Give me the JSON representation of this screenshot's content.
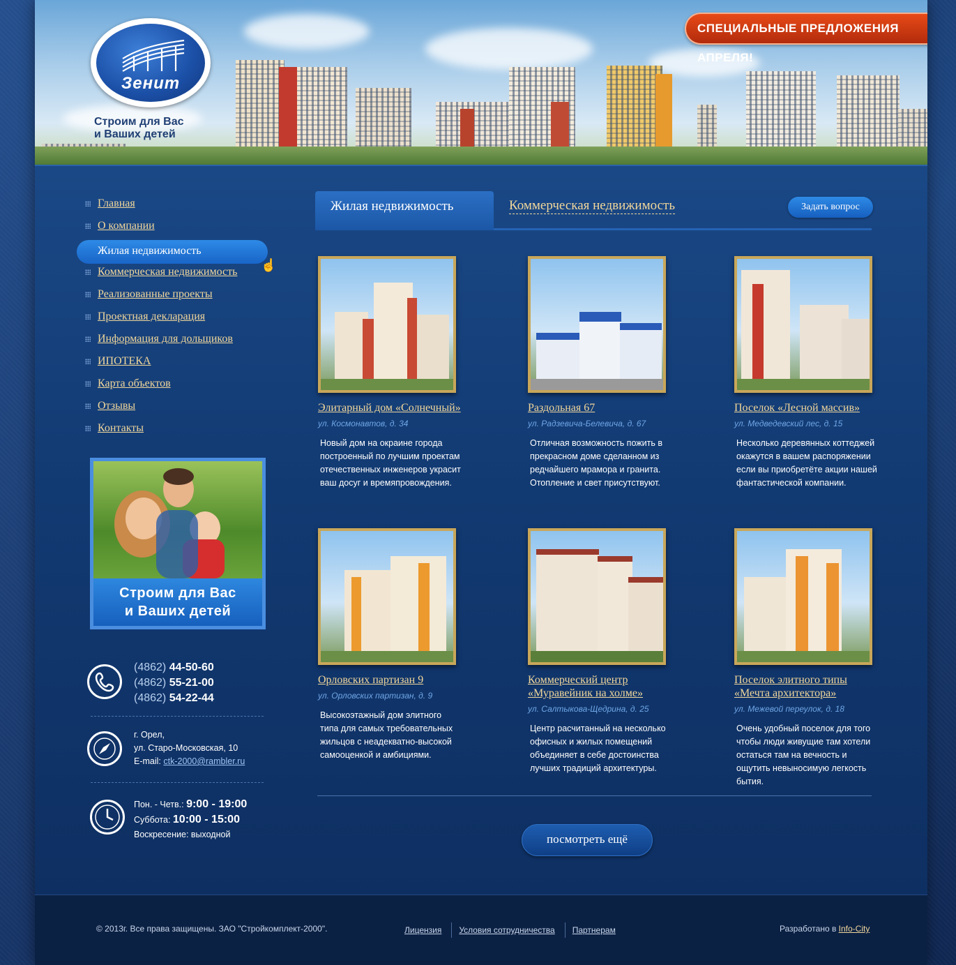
{
  "header": {
    "logo_text": "Зенит",
    "slogan_line1": "Строим для Вас",
    "slogan_line2": "и Ваших детей",
    "special_offer": "СПЕЦИАЛЬНЫЕ ПРЕДЛОЖЕНИЯ АПРЕЛЯ!"
  },
  "nav": {
    "items": [
      {
        "label": "Главная"
      },
      {
        "label": "О компании"
      },
      {
        "label": "Жилая недвижимость"
      },
      {
        "label": "Коммерческая недвижимость"
      },
      {
        "label": "Реализованные проекты"
      },
      {
        "label": "Проектная декларация"
      },
      {
        "label": "Информация для дольщиков"
      },
      {
        "label": "ИПОТЕКА"
      },
      {
        "label": "Карта объектов"
      },
      {
        "label": "Отзывы"
      },
      {
        "label": "Контакты"
      }
    ],
    "active_index": 2
  },
  "promo": {
    "line1": "Строим для Вас",
    "line2": "и Ваших детей"
  },
  "contacts": {
    "phones": [
      {
        "code": "(4862) ",
        "number": "44-50-60"
      },
      {
        "code": "(4862) ",
        "number": "55-21-00"
      },
      {
        "code": "(4862) ",
        "number": "54-22-44"
      }
    ],
    "city": "г. Орел,",
    "street": "ул. Старо-Московская, 10",
    "email_label": "E-mail: ",
    "email": "ctk-2000@rambler.ru",
    "hours": {
      "weekdays_label": "Пон. - Четв.: ",
      "weekdays_value": "9:00 - 19:00",
      "saturday_label": "Суббота: ",
      "saturday_value": "10:00 - 15:00",
      "sunday": "Воскресение: выходной"
    }
  },
  "tabs": {
    "active": "Жилая недвижимость",
    "other": "Коммерческая недвижимость",
    "ask_button": "Задать вопрос"
  },
  "cards": [
    {
      "title": "Элитарный дом «Солнечный»",
      "address": "ул. Космонавтов, д. 34",
      "description": "Новый дом на окраине города построенный по лучшим проектам отечественных инженеров украсит ваш досуг и времяпровождения."
    },
    {
      "title": "Раздольная 67",
      "address": "ул. Радзевича-Белевича, д. 67",
      "description": "Отличная возможность пожить в прекрасном доме сделанном из редчайшего мрамора и гранита. Отопление и свет присутствуют."
    },
    {
      "title": "Поселок «Лесной массив»",
      "address": "ул. Медведевский лес, д. 15",
      "description": "Несколько деревянных коттеджей окажутся в вашем распоряжении если вы приобретёте акции нашей фантастической компании."
    },
    {
      "title": "Орловских партизан 9",
      "address": "ул. Орловских партизан, д. 9",
      "description": "Высокоэтажный дом элитного типа для самых требовательных жильцов с неадекватно-высокой самооценкой и амбициями."
    },
    {
      "title": "Коммерческий центр «Муравейник на холме»",
      "address": "ул. Салтыкова-Щедрина, д. 25",
      "description": "Центр расчитанный на несколько офисных и жилых помещений объединяет в себе достоинства лучших традиций архитектуры."
    },
    {
      "title": "Поселок элитного типы «Мечта архитектора»",
      "address": "ул. Межевой переулок, д. 18",
      "description": "Очень удобный поселок для того чтобы люди живущие там хотели остаться там на вечность и ощутить невыносимую легкость бытия."
    }
  ],
  "more_button": "посмотреть ещё",
  "footer": {
    "copyright": "© 2013г. Все права защищены. ЗАО \"Стройкомплект-2000\".",
    "links": [
      "Лицензия",
      "Условия сотрудничества",
      "Партнерам"
    ],
    "developed_label": "Разработано в ",
    "developer": "Info-City"
  },
  "colors": {
    "link": "#f1d79b",
    "accent_blue": "#2e8ae6",
    "special_red": "#d13a10",
    "address_blue": "#6fa6e6"
  },
  "icons": [
    "phone-icon",
    "compass-icon",
    "clock-icon",
    "hand-cursor-icon"
  ]
}
